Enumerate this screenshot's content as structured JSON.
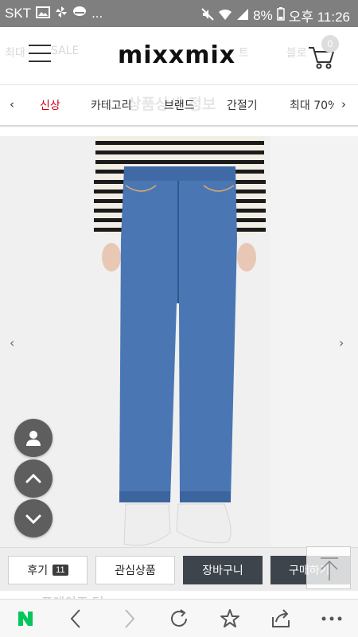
{
  "status_bar": {
    "carrier": "SKT",
    "left_icons": [
      "gallery-icon",
      "pinwheel-icon",
      "app-icon",
      "more-dots"
    ],
    "more": "...",
    "battery": "8%",
    "time": "오후 11:26"
  },
  "header": {
    "logo": "mixxmix",
    "ghost_left": "최대",
    "ghost_sale": "SALE",
    "ghost_right1": "트",
    "ghost_right2": "블로",
    "cart_count": "0"
  },
  "category_nav": {
    "ghost_title": "상품상세 정보",
    "prev": "‹",
    "next": "›",
    "items": [
      {
        "label": "신상",
        "active": true
      },
      {
        "label": "카테고리",
        "active": false
      },
      {
        "label": "브랜드",
        "active": false
      },
      {
        "label": "간절기",
        "active": false
      },
      {
        "label": "최대 70%",
        "active": false
      }
    ]
  },
  "gallery": {
    "prev": "‹",
    "next": "›"
  },
  "action_bar": {
    "review_label": "후기",
    "review_count": "11",
    "wishlist_label": "관심상품",
    "cart_label": "장바구니",
    "buy_label": "구매하기"
  },
  "below_ghost": "ㅅ 프레이즈 더",
  "colors": {
    "accent_red": "#d0021b",
    "dark_button": "#3d444c",
    "naver_green": "#03c75a",
    "status_bar": "#7f7f7f"
  }
}
